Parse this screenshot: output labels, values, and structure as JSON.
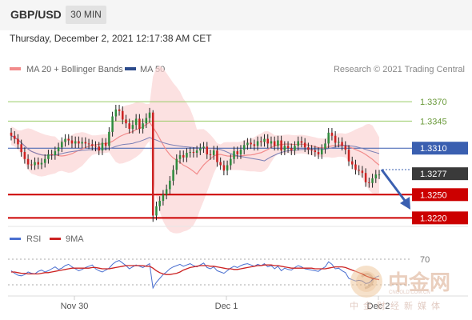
{
  "header": {
    "pair": "GBP/USD",
    "timeframe": "30 MIN"
  },
  "date_label": "Thursday, December 2, 2021 12:17:38 AM CET",
  "legend": {
    "ma20": "MA 20 + Bollinger Bands",
    "ma50": "MA 50",
    "copyright": "Research © 2021 Trading Central"
  },
  "rsi_legend": {
    "rsi": "RSI",
    "ma9": "9MA"
  },
  "colors": {
    "support": "#cc0000",
    "resistance": "#99cc66",
    "pivot": "#3a5fb0",
    "up": "#2e8b3d",
    "down": "#cc2222",
    "band": "#fbd4d4"
  },
  "chart_data": [
    {
      "type": "line",
      "title": "GBP/USD 30 MIN",
      "x_ticks": [
        "Nov 30",
        "Dec 1",
        "Dec 2"
      ],
      "levels": [
        {
          "label": "1.3370",
          "value": 1.337,
          "kind": "resistance"
        },
        {
          "label": "1.3345",
          "value": 1.3345,
          "kind": "resistance"
        },
        {
          "label": "1.3310",
          "value": 1.331,
          "kind": "pivot"
        },
        {
          "label": "1.3277",
          "value": 1.3277,
          "kind": "last"
        },
        {
          "label": "1.3250",
          "value": 1.325,
          "kind": "support"
        },
        {
          "label": "1.3220",
          "value": 1.322,
          "kind": "support"
        }
      ],
      "ylim": [
        1.3209,
        1.3398
      ],
      "closes": [
        1.3326,
        1.3322,
        1.3315,
        1.3305,
        1.3296,
        1.3289,
        1.3288,
        1.3292,
        1.3289,
        1.3291,
        1.3296,
        1.3302,
        1.3301,
        1.3306,
        1.3311,
        1.3318,
        1.3322,
        1.332,
        1.3316,
        1.3319,
        1.3316,
        1.3318,
        1.3316,
        1.3315,
        1.3313,
        1.3312,
        1.3307,
        1.3317,
        1.3313,
        1.3331,
        1.3351,
        1.336,
        1.3358,
        1.3347,
        1.3342,
        1.3335,
        1.334,
        1.3348,
        1.3335,
        1.3342,
        1.3349,
        1.3356,
        1.3223,
        1.3235,
        1.3242,
        1.325,
        1.3257,
        1.3268,
        1.3282,
        1.3296,
        1.3301,
        1.3298,
        1.3304,
        1.3305,
        1.3304,
        1.3307,
        1.331,
        1.3312,
        1.3302,
        1.3301,
        1.3307,
        1.3292,
        1.3288,
        1.3281,
        1.3288,
        1.3296,
        1.3306,
        1.3302,
        1.3308,
        1.3314,
        1.3317,
        1.3315,
        1.3313,
        1.3319,
        1.3318,
        1.3322,
        1.3316,
        1.3319,
        1.3313,
        1.332,
        1.3307,
        1.3313,
        1.331,
        1.3307,
        1.3313,
        1.3319,
        1.3317,
        1.3311,
        1.3308,
        1.3307,
        1.3305,
        1.3302,
        1.3309,
        1.3316,
        1.333,
        1.3326,
        1.3317,
        1.3318,
        1.3313,
        1.3308,
        1.3293,
        1.3289,
        1.3282,
        1.3281,
        1.3278,
        1.3266,
        1.3265,
        1.3271,
        1.3276,
        1.3276
      ],
      "annotation": "arrow pointing down toward 1.3220"
    },
    {
      "type": "line",
      "title": "RSI",
      "series": [
        {
          "name": "RSI",
          "values": [
            52,
            48,
            45,
            44,
            46,
            50,
            48,
            47,
            51,
            53,
            50,
            52,
            55,
            58,
            54,
            56,
            60,
            62,
            58,
            55,
            52,
            54,
            57,
            59,
            61,
            55,
            52,
            50,
            53,
            56,
            62,
            66,
            68,
            64,
            60,
            55,
            58,
            61,
            59,
            57,
            60,
            63,
            25,
            34,
            40,
            46,
            50,
            55,
            58,
            60,
            62,
            59,
            61,
            63,
            60,
            58,
            61,
            64,
            57,
            55,
            58,
            52,
            50,
            48,
            52,
            56,
            59,
            57,
            60,
            62,
            63,
            61,
            59,
            62,
            60,
            63,
            58,
            60,
            55,
            59,
            52,
            56,
            54,
            53,
            57,
            60,
            58,
            55,
            54,
            53,
            52,
            51,
            55,
            58,
            66,
            62,
            55,
            56,
            52,
            49,
            40,
            38,
            36,
            37,
            36,
            32,
            33,
            38,
            42,
            44
          ]
        },
        {
          "name": "9MA",
          "values": [
            50,
            50,
            49,
            48,
            48,
            47,
            47,
            47,
            47,
            48,
            49,
            49,
            50,
            51,
            52,
            53,
            54,
            55,
            56,
            56,
            56,
            56,
            56,
            56,
            57,
            57,
            56,
            55,
            55,
            55,
            56,
            57,
            58,
            59,
            60,
            60,
            60,
            60,
            60,
            60,
            59,
            59,
            56,
            52,
            49,
            47,
            46,
            46,
            47,
            48,
            50,
            53,
            55,
            57,
            58,
            59,
            60,
            60,
            60,
            59,
            59,
            58,
            57,
            56,
            55,
            55,
            54,
            54,
            55,
            56,
            57,
            58,
            59,
            60,
            60,
            61,
            61,
            61,
            60,
            60,
            59,
            58,
            57,
            56,
            56,
            56,
            56,
            56,
            56,
            56,
            55,
            55,
            55,
            55,
            56,
            57,
            58,
            58,
            58,
            57,
            55,
            53,
            51,
            49,
            47,
            44,
            42,
            40,
            39,
            38
          ]
        }
      ],
      "levels": [
        {
          "label": "70",
          "value": 70
        }
      ],
      "ylim": [
        15,
        85
      ]
    }
  ]
}
